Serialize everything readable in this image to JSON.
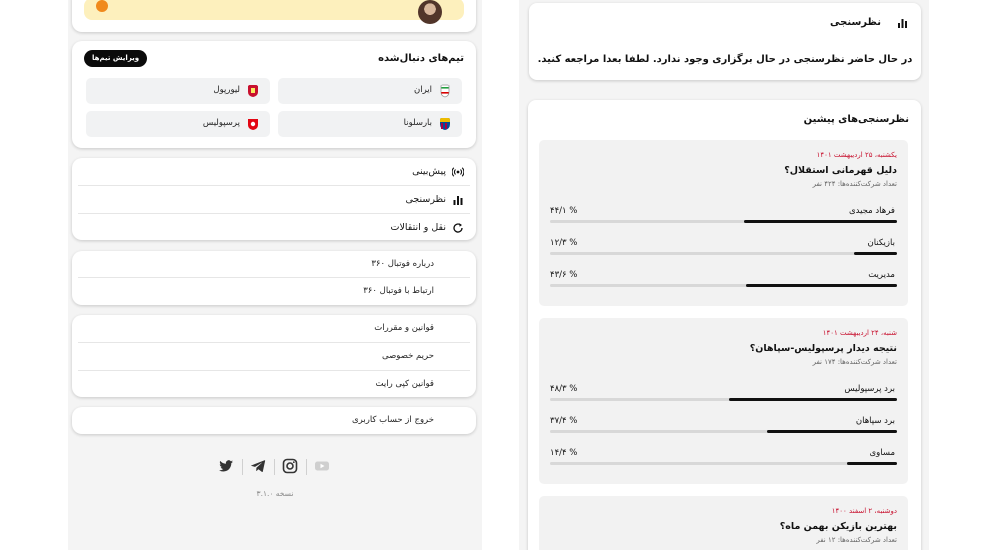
{
  "sidebar": {
    "followed_teams": {
      "title": "تیم‌های دنبال‌شده",
      "edit_label": "ویرایش تیم‌ها",
      "teams": [
        {
          "name": "ایران",
          "color": "#ffffff"
        },
        {
          "name": "لیورپول",
          "color": "#c8102e"
        },
        {
          "name": "بارسلونا",
          "color": "#a50044"
        },
        {
          "name": "پرسپولیس",
          "color": "#e30613"
        }
      ]
    },
    "menu": [
      {
        "label": "پیش‌بینی",
        "icon": "broadcast-icon"
      },
      {
        "label": "نظرسنجی",
        "icon": "bar-chart-icon"
      },
      {
        "label": "نقل و انتقالات",
        "icon": "refresh-icon"
      }
    ],
    "about": [
      "درباره فوتبال ۳۶۰",
      "ارتباط با فوتبال ۳۶۰"
    ],
    "rules": [
      "قوانین و مقررات",
      "حریم خصوصی",
      "قوانین کپی رایت"
    ],
    "logout": "خروج از حساب کاربری",
    "socials": [
      "youtube-icon",
      "instagram-icon",
      "telegram-icon",
      "twitter-icon"
    ],
    "version": "نسخه ۳.۱.۰"
  },
  "current_poll": {
    "title": "نظرسنجی",
    "message": "در حال حاضر نظرسنجی در حال برگزاری وجود ندارد. لطفا بعدا مراجعه کنید."
  },
  "previous_polls": {
    "title": "نظرسنجی‌های پیشین",
    "polls": [
      {
        "date": "یکشنبه، ۲۵ اردیبهشت ۱۴۰۱",
        "question": "دلیل قهرمانی استقلال؟",
        "participants": "تعداد شرکت‌کننده‌ها: ۴۲۴ نفر",
        "options": [
          {
            "label": "فرهاد مجیدی",
            "pct_text": "% ۴۴/۱",
            "pct": 44.1
          },
          {
            "label": "بازیکنان",
            "pct_text": "% ۱۲/۳",
            "pct": 12.3
          },
          {
            "label": "مدیریت",
            "pct_text": "% ۴۳/۶",
            "pct": 43.6
          }
        ]
      },
      {
        "date": "شنبه، ۲۴ اردیبهشت ۱۴۰۱",
        "question": "نتیجه دیدار پرسپولیس-سپاهان؟",
        "participants": "تعداد شرکت‌کننده‌ها: ۱۷۴ نفر",
        "options": [
          {
            "label": "برد پرسپولیس",
            "pct_text": "% ۴۸/۳",
            "pct": 48.3
          },
          {
            "label": "برد سپاهان",
            "pct_text": "% ۳۷/۴",
            "pct": 37.4
          },
          {
            "label": "مساوی",
            "pct_text": "% ۱۴/۴",
            "pct": 14.4
          }
        ]
      },
      {
        "date": "دوشنبه، ۲ اسفند ۱۴۰۰",
        "question": "بهترین بازیکن بهمن ماه؟",
        "participants": "تعداد شرکت‌کننده‌ها: ۱۲ نفر",
        "options": []
      }
    ]
  }
}
